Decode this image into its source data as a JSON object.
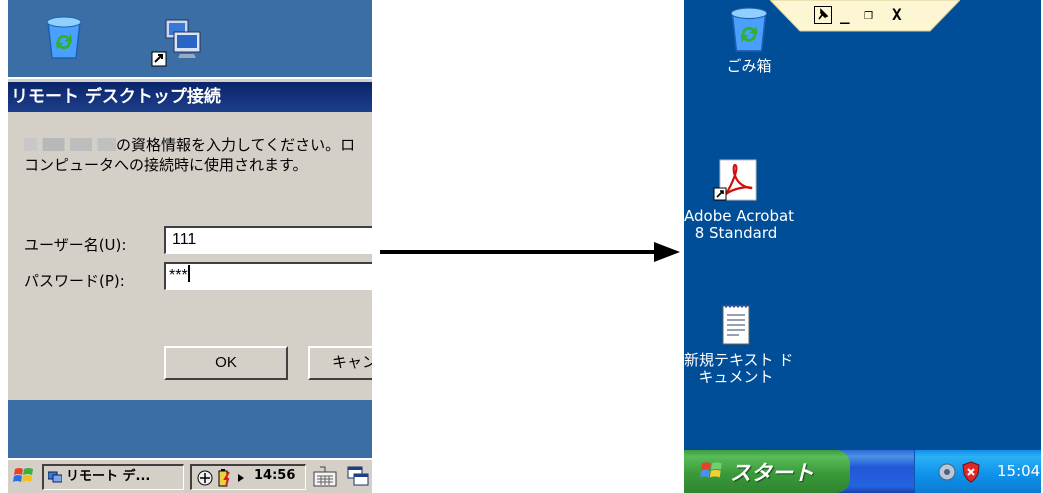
{
  "left_device": {
    "dialog": {
      "title": "リモート デスクトップ接続",
      "prompt_line1": "の資格情報を入力してください。ロ",
      "prompt_line2": "コンピュータへの接続時に使用されます。",
      "username_label": "ユーザー名(U):",
      "username_value": "111",
      "password_label": "パスワード(P):",
      "password_value": "***",
      "ok_label": "OK",
      "cancel_label": "キャン"
    },
    "taskbar": {
      "task_label": "リモート デ...",
      "clock": "14:56"
    },
    "icons": [
      "recycle-bin-icon",
      "remote-desktop-shortcut-icon"
    ]
  },
  "remote_desktop": {
    "icons": [
      {
        "label": "ごみ箱",
        "icon": "recycle-bin-icon"
      },
      {
        "label_line1": "Adobe Acrobat",
        "label_line2": "8 Standard",
        "icon": "acrobat-icon"
      },
      {
        "label_line1": "新規テキスト ド",
        "label_line2": "キュメント",
        "icon": "text-document-icon"
      }
    ],
    "connection_bar": {
      "minimize": "_",
      "restore": "❐",
      "close": "X"
    },
    "taskbar": {
      "start_label": "スタート",
      "clock": "15:04"
    }
  },
  "colors": {
    "wm_desktop": "#3a6ea5",
    "xp_desktop": "#004e98",
    "xp_start_green": "#3a9a3a",
    "title_bar": "#0a246a"
  }
}
